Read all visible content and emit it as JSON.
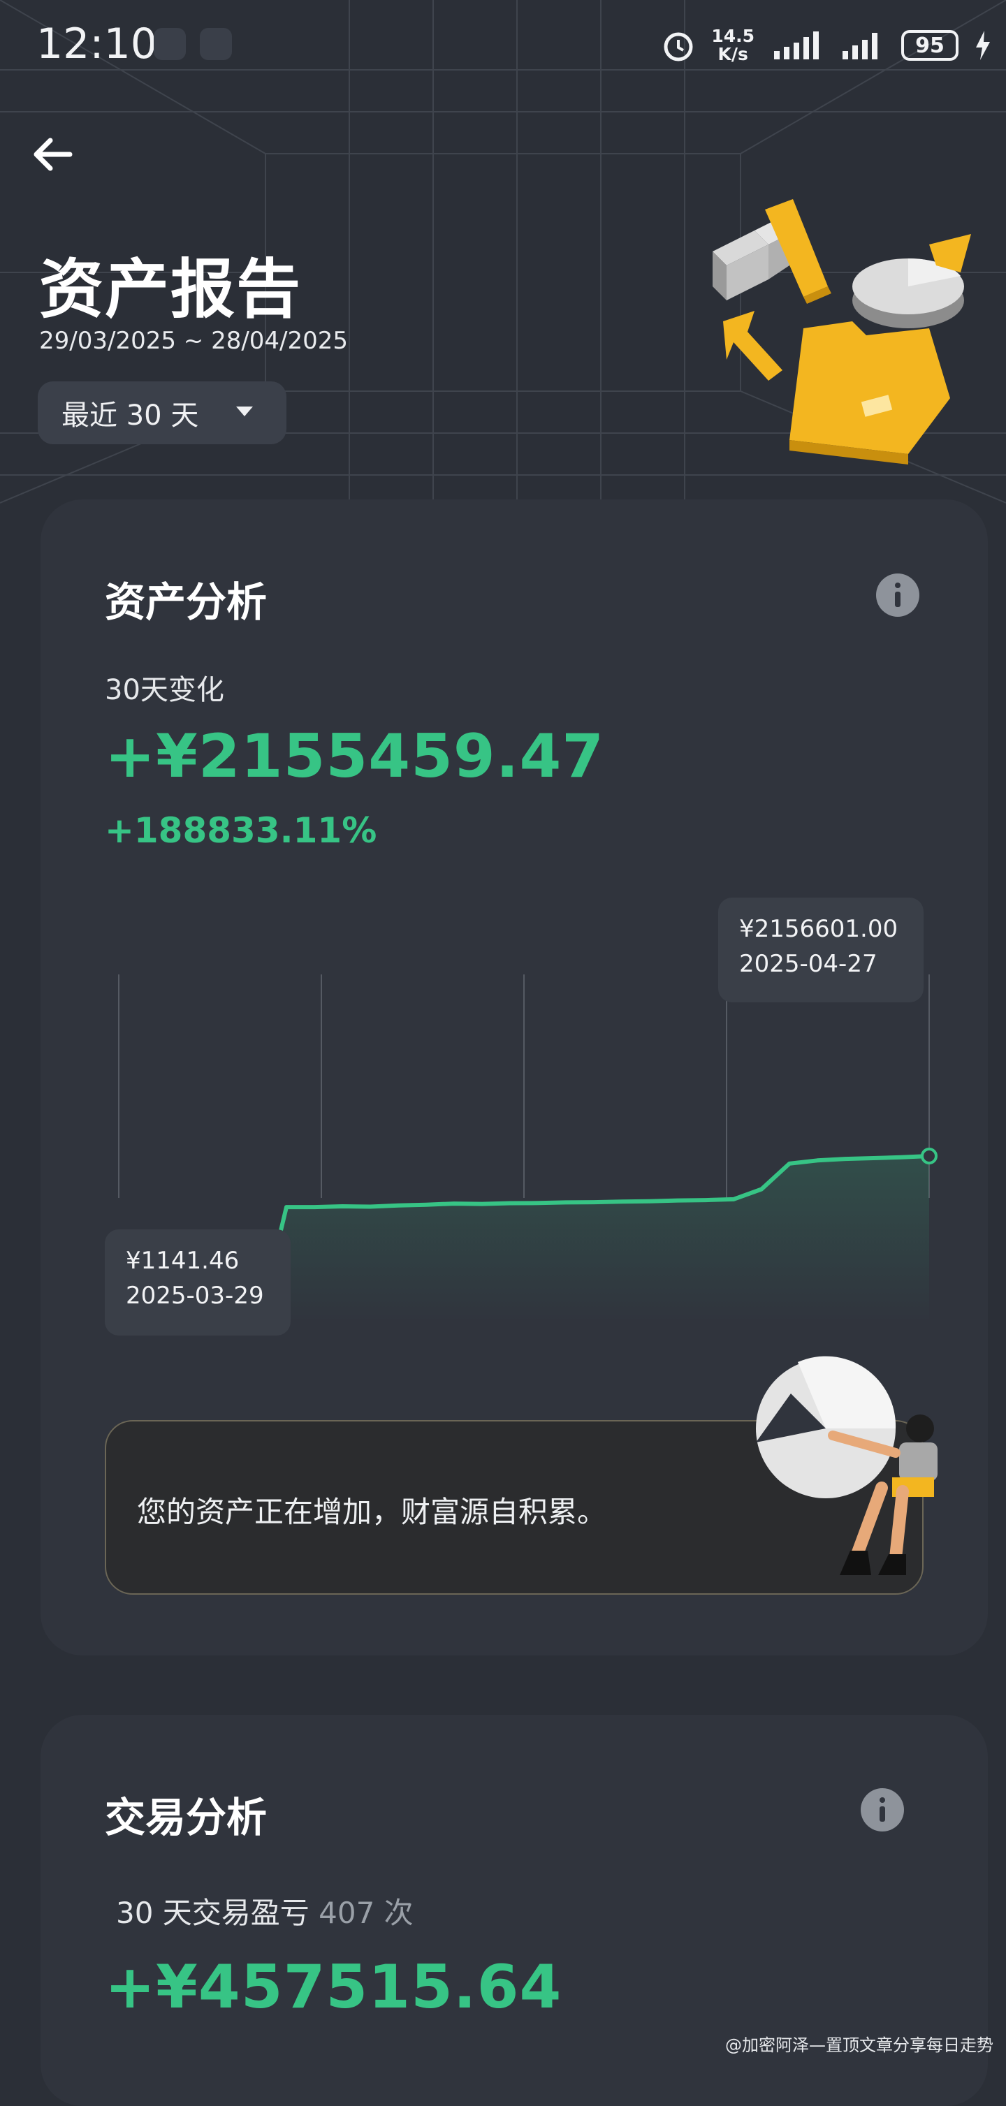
{
  "status_bar": {
    "time": "12:10",
    "net_speed_value": "14.5",
    "net_speed_unit": "K/s",
    "battery": "95",
    "icons": [
      "notification-app-icon",
      "game-app-icon",
      "alarm-icon",
      "signal-icon",
      "signal-icon",
      "battery-icon",
      "charging-icon"
    ]
  },
  "header": {
    "title": "资产报告",
    "date_range": "29/03/2025 ~ 28/04/2025",
    "period_select": "最近 30 天"
  },
  "asset_card": {
    "title": "资产分析",
    "change_label": "30天变化",
    "change_amount": "+¥2155459.47",
    "change_percent": "+188833.11%",
    "tooltip_start": {
      "value": "¥1141.46",
      "date": "2025-03-29"
    },
    "tooltip_end": {
      "value": "¥2156601.00",
      "date": "2025-04-27"
    },
    "message": "您的资产正在增加，财富源自积累。"
  },
  "chart_data": {
    "type": "area",
    "title": "",
    "xlabel": "",
    "ylabel": "",
    "x": [
      "2025-03-29",
      "2025-03-30",
      "2025-03-31",
      "2025-04-01",
      "2025-04-02",
      "2025-04-03",
      "2025-04-04",
      "2025-04-05",
      "2025-04-06",
      "2025-04-07",
      "2025-04-08",
      "2025-04-09",
      "2025-04-10",
      "2025-04-11",
      "2025-04-12",
      "2025-04-13",
      "2025-04-14",
      "2025-04-15",
      "2025-04-16",
      "2025-04-17",
      "2025-04-18",
      "2025-04-19",
      "2025-04-20",
      "2025-04-21",
      "2025-04-22",
      "2025-04-23",
      "2025-04-24",
      "2025-04-25",
      "2025-04-26",
      "2025-04-27"
    ],
    "values": [
      1141.46,
      1141.46,
      1141.46,
      1141.46,
      1141.46,
      1141.46,
      1500000,
      1500000,
      1510000,
      1505000,
      1520000,
      1530000,
      1545000,
      1540000,
      1550000,
      1552000,
      1560000,
      1563000,
      1570000,
      1575000,
      1585000,
      1590000,
      1600000,
      1730000,
      2060000,
      2100000,
      2120000,
      2130000,
      2140000,
      2156601.0
    ],
    "ylim": [
      0,
      2156601
    ],
    "color": "#37c485",
    "grid": "vertical lines",
    "annotations": [
      {
        "x": "2025-03-29",
        "label": "¥1141.46"
      },
      {
        "x": "2025-04-27",
        "label": "¥2156601.00"
      }
    ]
  },
  "trade_card": {
    "title": "交易分析",
    "pnl_label": "30 天交易盈亏",
    "trade_count": "407 次",
    "pnl_amount": "+¥457515.64"
  },
  "watermark": "@加密阿泽—置顶文章分享每日走势",
  "colors": {
    "background": "#2b2f37",
    "card": "#30343d",
    "positive": "#37c485",
    "accent": "#f3b620"
  }
}
